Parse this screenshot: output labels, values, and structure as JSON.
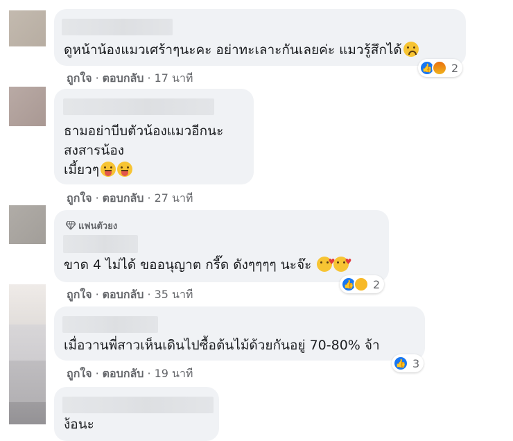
{
  "comments": [
    {
      "text_lines": [
        "ดูหน้าน้องแมวเศร้าๆนะคะ อย่าทะเลาะกันเลยค่ะ แมวรู้สึกได้"
      ],
      "like_label": "ถูกใจ",
      "reply_label": "ตอบกลับ",
      "time": "17 นาที",
      "reaction_count": "2",
      "reaction_icons": [
        "like-icon",
        "angry-icon"
      ],
      "emoji": [
        "frowning-face-emoji"
      ]
    },
    {
      "text_lines": [
        "ธามอย่าบีบตัวน้องแมวอีกนะ",
        "สงสารน้อง",
        "เมี้ยวๆ"
      ],
      "like_label": "ถูกใจ",
      "reply_label": "ตอบกลับ",
      "time": "27 นาที",
      "emoji": [
        "tongue-face-emoji",
        "tongue-face-emoji"
      ]
    },
    {
      "badge": "แฟนตัวยง",
      "text_lines": [
        "ขาด 4 ไม่ได้ ขออนุญาต กรี๊ด ดังๆๆๆๆ นะจ๊ะ"
      ],
      "like_label": "ถูกใจ",
      "reply_label": "ตอบกลับ",
      "time": "35 นาที",
      "reaction_count": "2",
      "reaction_icons": [
        "like-icon",
        "haha-icon"
      ],
      "emoji": [
        "smiling-face-with-hearts-emoji",
        "smiling-face-with-hearts-emoji"
      ]
    },
    {
      "text_lines": [
        "เมื่อวานพี่สาวเห็นเดินไปซื้อต้นไม้ด้วยกันอยู่ 70-80% จ้า"
      ],
      "like_label": "ถูกใจ",
      "reply_label": "ตอบกลับ",
      "time": "19 นาที",
      "reaction_count": "3",
      "reaction_icons": [
        "like-icon"
      ]
    },
    {
      "text_lines": [
        "ง้อนะ"
      ]
    }
  ],
  "separator": "·",
  "colors": {
    "bubble": "#f0f2f5",
    "like": "#1877f2",
    "meta": "#65676b"
  }
}
